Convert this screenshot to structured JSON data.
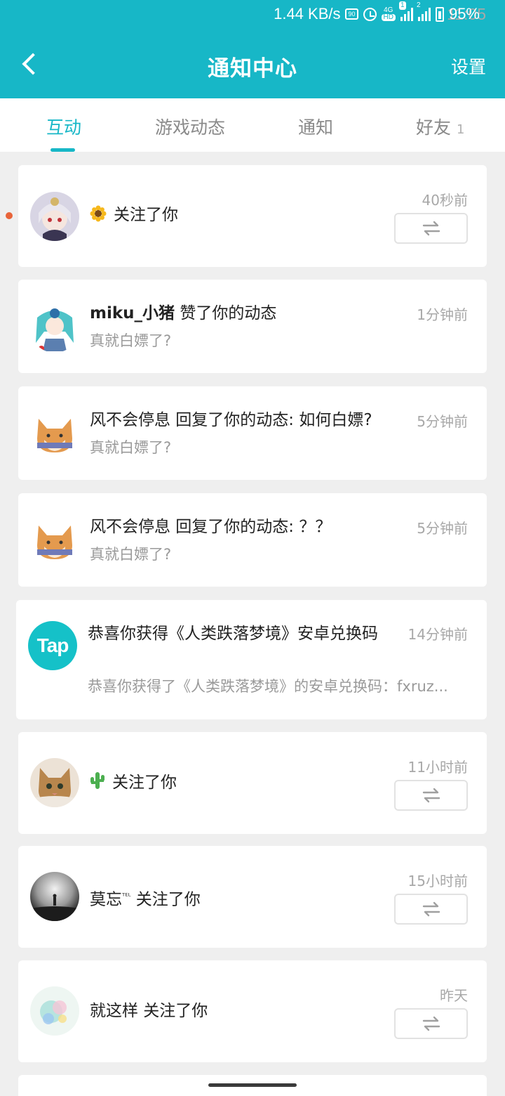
{
  "status_bar": {
    "time": "11:05",
    "speed": "1.44 KB/s",
    "battery": "95%",
    "icons": [
      "data-saver-icon",
      "alarm-icon",
      "4g-hd-icon",
      "signal-icon",
      "signal-2-icon",
      "battery-icon"
    ],
    "badge_4g": "4G",
    "badge_hd": "HD",
    "sim1": "1",
    "sim2": "2"
  },
  "header": {
    "title": "通知中心",
    "settings_label": "设置",
    "accent": "#17b7c7"
  },
  "tabs": [
    {
      "label": "互动",
      "active": true
    },
    {
      "label": "游戏动态"
    },
    {
      "label": "通知"
    },
    {
      "label": "好友",
      "count": "1"
    }
  ],
  "notifications": [
    {
      "avatar": "anime-girl-avatar",
      "emoji": "sunflower",
      "user": "",
      "action": "关注了你",
      "time": "40秒前",
      "follow_button": true,
      "unread": true
    },
    {
      "avatar": "miku-avatar",
      "user": "miku_小猪",
      "action": " 赞了你的动态",
      "sub": "真就白嫖了?",
      "time": "1分钟前"
    },
    {
      "avatar": "shiba-avatar",
      "user": "",
      "action": "风不会停息 回复了你的动态: 如何白嫖?",
      "sub": "真就白嫖了?",
      "time": "5分钟前"
    },
    {
      "avatar": "shiba-avatar",
      "user": "",
      "action": "风不会停息 回复了你的动态: ？？",
      "sub": "真就白嫖了?",
      "time": "5分钟前"
    },
    {
      "avatar": "tap-logo",
      "logo_text": "Tap",
      "action": "恭喜你获得《人类跌落梦境》安卓兑换码",
      "sub": "恭喜你获得了《人类跌落梦境》的安卓兑换码：fxruz...",
      "time": "14分钟前"
    },
    {
      "avatar": "cat-avatar",
      "emoji": "cactus",
      "action": "关注了你",
      "time": "11小时前",
      "follow_button": true
    },
    {
      "avatar": "foggy-person-avatar",
      "user": "莫忘",
      "tel": "ᵀᴱᴸ",
      "action": " 关注了你",
      "time": "15小时前",
      "follow_button": true
    },
    {
      "avatar": "watercolor-avatar",
      "user": "就这样",
      "action": " 关注了你",
      "time": "昨天",
      "follow_button": true
    }
  ]
}
